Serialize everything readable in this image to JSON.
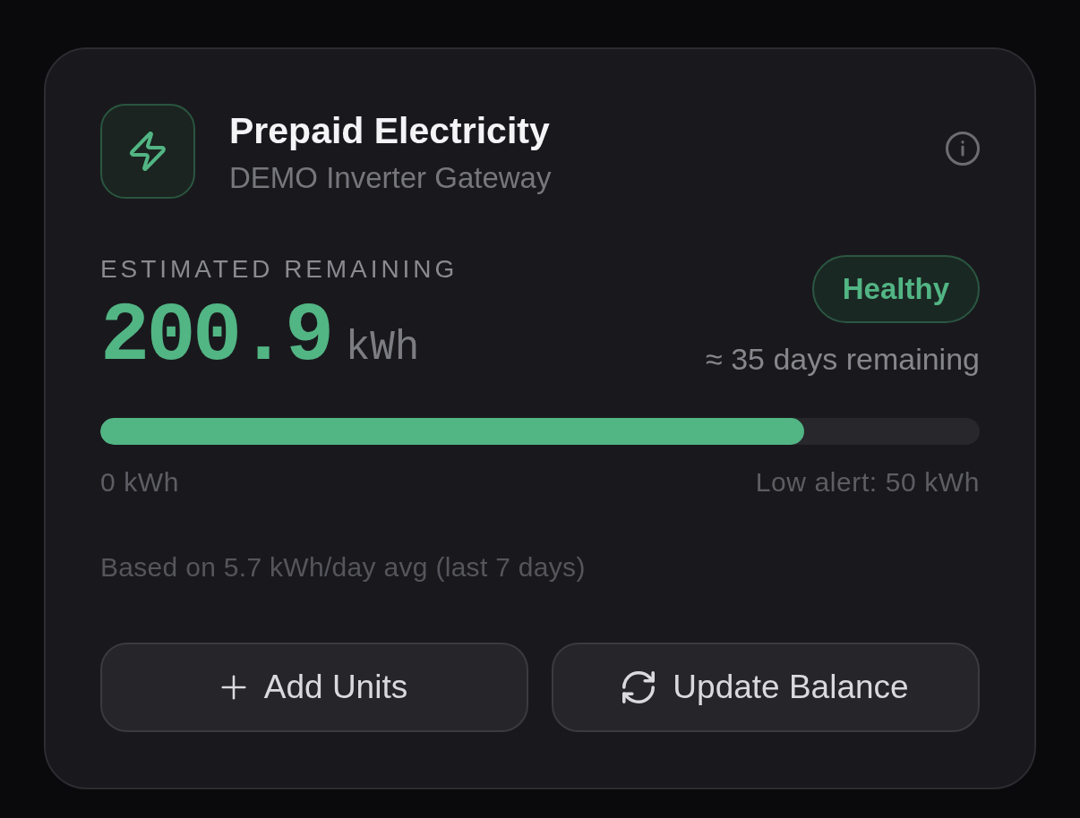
{
  "card": {
    "title": "Prepaid Electricity",
    "subtitle": "DEMO Inverter Gateway",
    "estimate": {
      "label": "ESTIMATED REMAINING",
      "value": "200.9",
      "unit": "kWh"
    },
    "status_badge": "Healthy",
    "days_remaining": "≈ 35 days remaining",
    "progress": {
      "level": 0.8,
      "min_label": "0 kWh",
      "alert_label": "Low alert: 50 kWh"
    },
    "footnote": "Based on 5.7 kWh/day avg (last 7 days)",
    "buttons": [
      {
        "kind": "add",
        "label": "Add Units"
      },
      {
        "kind": "update",
        "label": "Update Balance"
      }
    ]
  }
}
